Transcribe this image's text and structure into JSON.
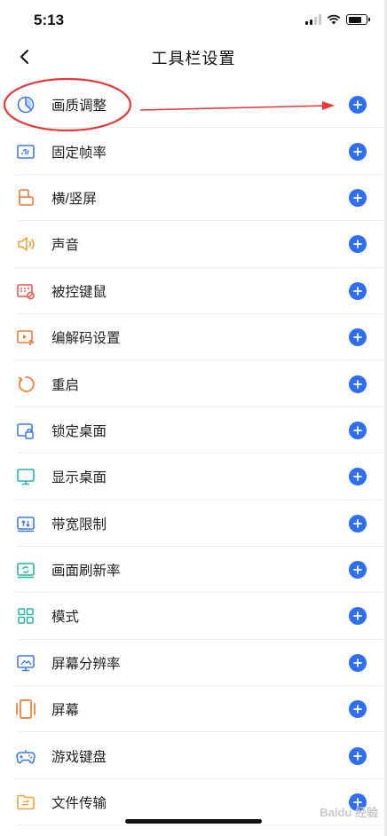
{
  "status_bar": {
    "time": "5:13"
  },
  "nav": {
    "title": "工具栏设置"
  },
  "items": [
    {
      "label": "画质调整",
      "icon": "quality-icon",
      "color": "#3f7be8"
    },
    {
      "label": "固定帧率",
      "icon": "frame-rate-icon",
      "color": "#3f7be8"
    },
    {
      "label": "横/竖屏",
      "icon": "rotate-screen-icon",
      "color": "#f07a3b"
    },
    {
      "label": "声音",
      "icon": "speaker-icon",
      "color": "#f0a23b"
    },
    {
      "label": "被控键鼠",
      "icon": "keyboard-mouse-icon",
      "color": "#e8584f"
    },
    {
      "label": "编解码设置",
      "icon": "codec-icon",
      "color": "#f07a3b"
    },
    {
      "label": "重启",
      "icon": "restart-icon",
      "color": "#f07a3b"
    },
    {
      "label": "锁定桌面",
      "icon": "lock-desktop-icon",
      "color": "#3f7be8"
    },
    {
      "label": "显示桌面",
      "icon": "show-desktop-icon",
      "color": "#27b5a4"
    },
    {
      "label": "带宽限制",
      "icon": "bandwidth-icon",
      "color": "#3f7be8"
    },
    {
      "label": "画面刷新率",
      "icon": "refresh-rate-icon",
      "color": "#27b5a4"
    },
    {
      "label": "模式",
      "icon": "mode-grid-icon",
      "color": "#27b5a4"
    },
    {
      "label": "屏幕分辨率",
      "icon": "resolution-icon",
      "color": "#3f7be8"
    },
    {
      "label": "屏幕",
      "icon": "screen-icon",
      "color": "#f07a3b"
    },
    {
      "label": "游戏键盘",
      "icon": "gamepad-icon",
      "color": "#3f7be8"
    },
    {
      "label": "文件传输",
      "icon": "file-transfer-icon",
      "color": "#f0a23b"
    }
  ],
  "accent": "#2f6ef0",
  "annotation_color": "#e8393a",
  "watermark": "Baidu 经验"
}
